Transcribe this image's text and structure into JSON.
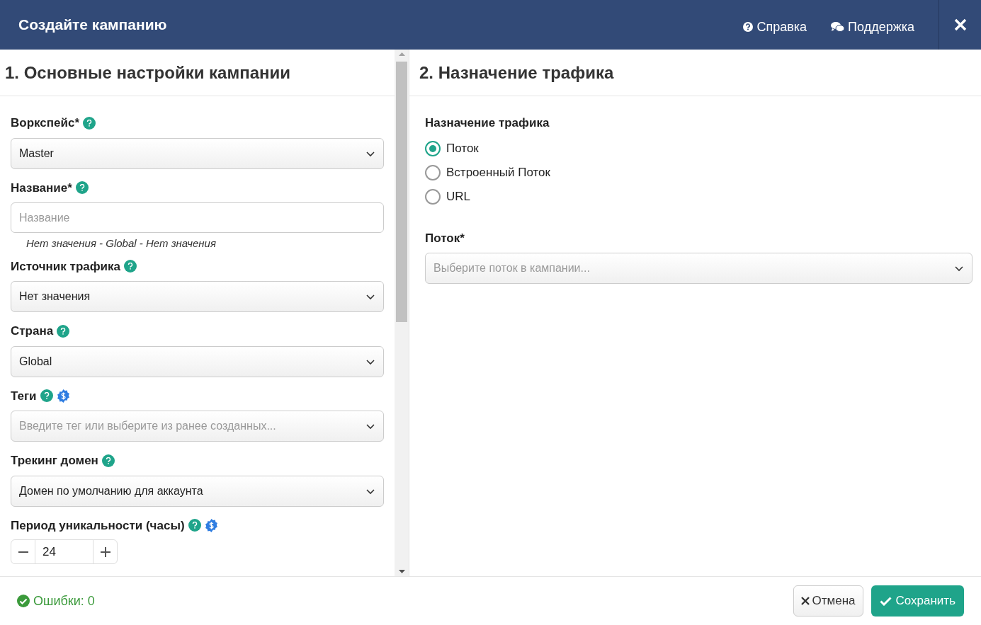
{
  "header": {
    "title": "Создайте кампанию",
    "links": [
      {
        "kind": "help",
        "label": "Справка"
      },
      {
        "kind": "support",
        "label": "Поддержка"
      }
    ]
  },
  "left": {
    "title": "1. Основные настройки кампании",
    "fields": [
      {
        "kind": "select",
        "label": "Воркспейс*",
        "help": true,
        "premium": false,
        "value": "Master"
      },
      {
        "kind": "input",
        "label": "Название*",
        "help": true,
        "premium": false,
        "placeholder": "Название",
        "hint": "Нет значения - Global - Нет значения"
      },
      {
        "kind": "select",
        "label": "Источник трафика",
        "help": true,
        "premium": false,
        "value": "Нет значения"
      },
      {
        "kind": "select",
        "label": "Страна",
        "help": true,
        "premium": false,
        "value": "Global"
      },
      {
        "kind": "select",
        "label": "Теги",
        "help": true,
        "premium": true,
        "placeholder": "Введите тег или выберите из ранее созданных..."
      },
      {
        "kind": "select",
        "label": "Трекинг домен",
        "help": true,
        "premium": false,
        "value": "Домен по умолчанию для аккаунта"
      },
      {
        "kind": "stepper",
        "label": "Период уникальности (часы)",
        "help": true,
        "premium": true,
        "value": "24"
      }
    ]
  },
  "right": {
    "title": "2. Назначение трафика",
    "group_label": "Назначение трафика",
    "options": [
      {
        "label": "Поток",
        "selected": true
      },
      {
        "label": "Встроенный Поток",
        "selected": false
      },
      {
        "label": "URL",
        "selected": false
      }
    ],
    "flow": {
      "label": "Поток*",
      "placeholder": "Выберите поток в кампании..."
    }
  },
  "footer": {
    "errors": "Ошибки: 0",
    "buttons": [
      {
        "kind": "cancel",
        "label": "Отмена"
      },
      {
        "kind": "save",
        "label": "Сохранить"
      }
    ]
  }
}
